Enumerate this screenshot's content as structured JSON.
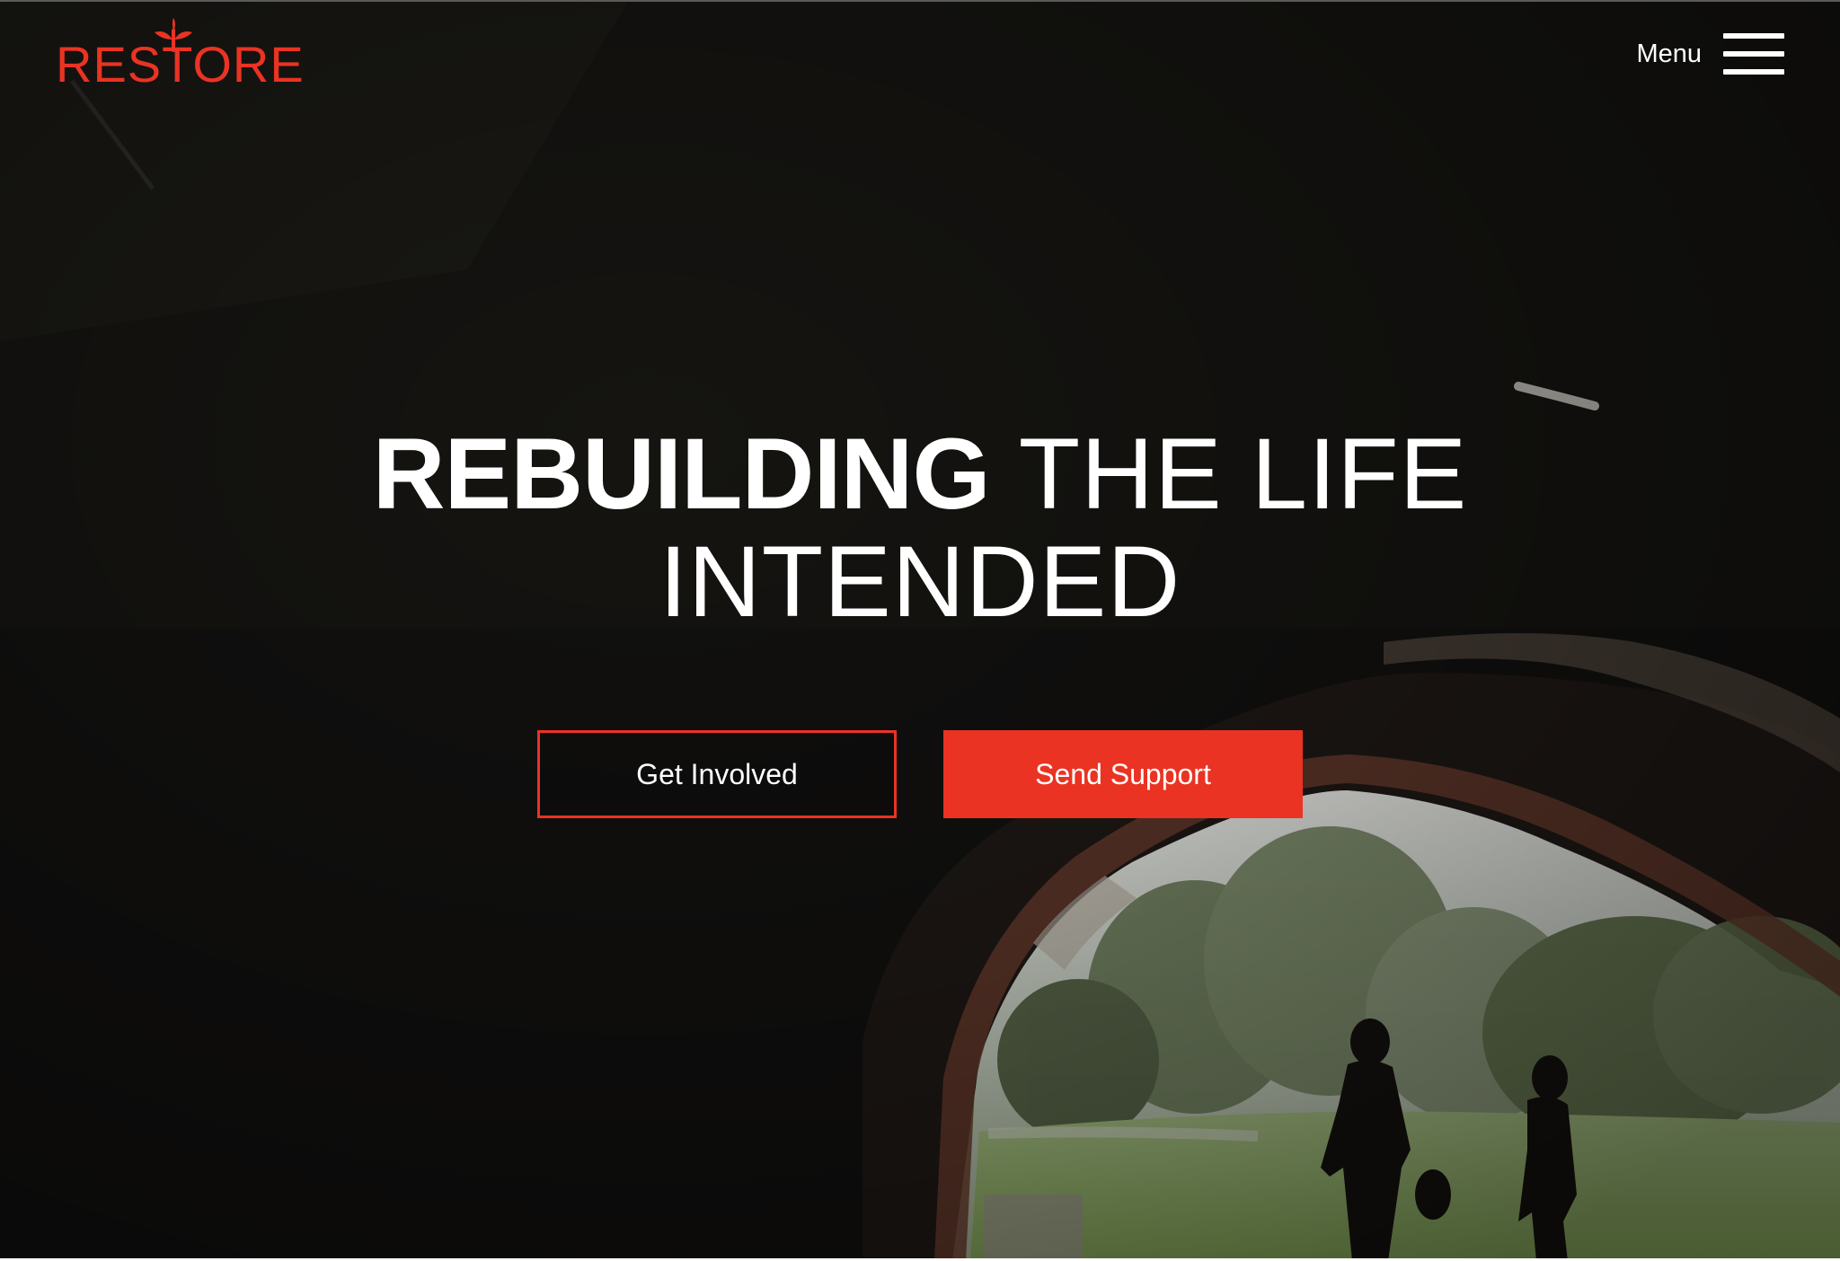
{
  "brand": {
    "name": "RESTORE",
    "color": "#ea3323",
    "logo_icon": "leaf-sprout-icon"
  },
  "nav": {
    "menu_label": "Menu",
    "menu_icon": "hamburger-menu-icon"
  },
  "hero": {
    "headline_bold": "REBUILDING",
    "headline_light_1": "THE LIFE",
    "headline_light_2": "INTENDED",
    "background": "dark video still of a pointed stone archway opening onto a sunny park with two silhouetted walkers"
  },
  "actions": {
    "primary_outline_label": "Get Involved",
    "primary_solid_label": "Send Support"
  }
}
